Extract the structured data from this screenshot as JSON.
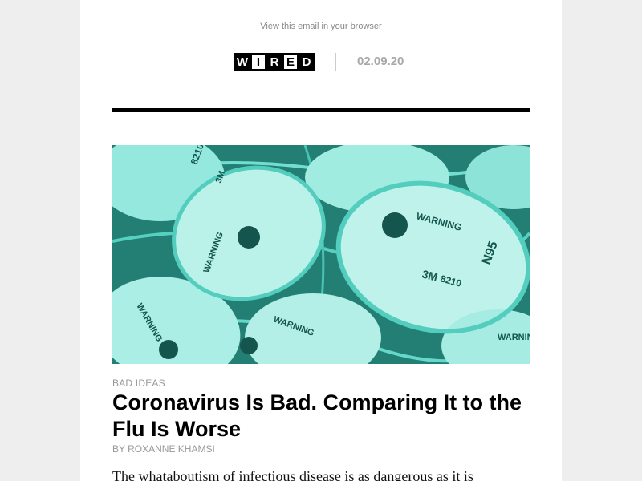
{
  "email": {
    "view_in_browser": "View this email in your browser",
    "brand_letters": [
      "W",
      "I",
      "R",
      "E",
      "D"
    ],
    "date": "02.09.20"
  },
  "hero": {
    "icon": "n95-masks-photo",
    "mask_texts": [
      "WARNING",
      "3M",
      "8210",
      "N95"
    ],
    "tint_color": "#3fc8b8"
  },
  "article": {
    "section": "BAD IDEAS",
    "headline": "Coronavirus Is Bad. Comparing It to the Flu Is Worse",
    "byline": "BY ROXANNE KHAMSI",
    "dek": "The whataboutism of infectious disease is as dangerous as it is"
  }
}
